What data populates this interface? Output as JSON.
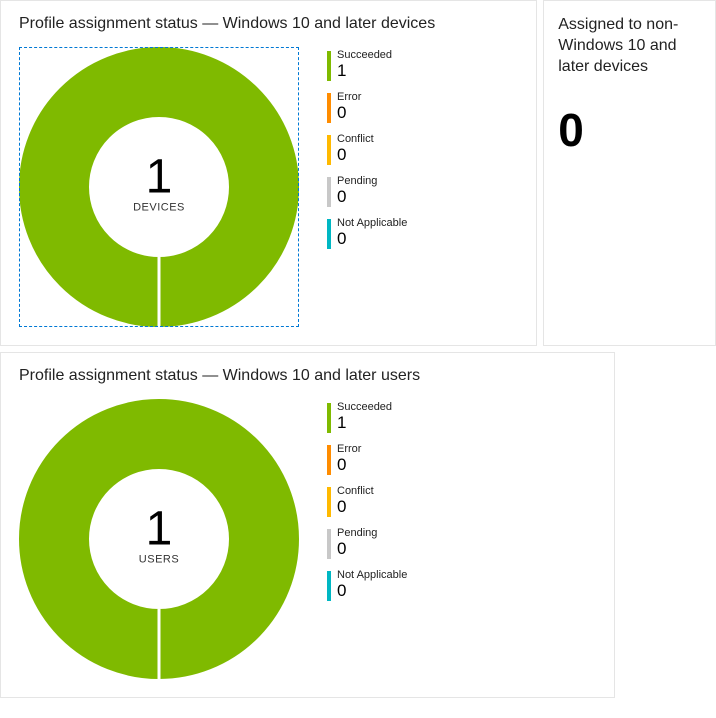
{
  "devices_card": {
    "title": "Profile assignment status — Windows 10 and later devices",
    "center_value": "1",
    "center_label": "DEVICES",
    "legend": [
      {
        "label": "Succeeded",
        "value": "1",
        "color": "#7FBA00"
      },
      {
        "label": "Error",
        "value": "0",
        "color": "#FF8C00"
      },
      {
        "label": "Conflict",
        "value": "0",
        "color": "#FFB900"
      },
      {
        "label": "Pending",
        "value": "0",
        "color": "#C8C8C8"
      },
      {
        "label": "Not Applicable",
        "value": "0",
        "color": "#00B7C3"
      }
    ]
  },
  "users_card": {
    "title": "Profile assignment status — Windows 10 and later users",
    "center_value": "1",
    "center_label": "USERS",
    "legend": [
      {
        "label": "Succeeded",
        "value": "1",
        "color": "#7FBA00"
      },
      {
        "label": "Error",
        "value": "0",
        "color": "#FF8C00"
      },
      {
        "label": "Conflict",
        "value": "0",
        "color": "#FFB900"
      },
      {
        "label": "Pending",
        "value": "0",
        "color": "#C8C8C8"
      },
      {
        "label": "Not Applicable",
        "value": "0",
        "color": "#00B7C3"
      }
    ]
  },
  "side_card": {
    "title": "Assigned to non-Windows 10 and later devices",
    "value": "0"
  },
  "chart_data": [
    {
      "type": "pie",
      "title": "Profile assignment status — Windows 10 and later devices",
      "categories": [
        "Succeeded",
        "Error",
        "Conflict",
        "Pending",
        "Not Applicable"
      ],
      "values": [
        1,
        0,
        0,
        0,
        0
      ],
      "center_value": 1,
      "center_label": "DEVICES"
    },
    {
      "type": "pie",
      "title": "Profile assignment status — Windows 10 and later users",
      "categories": [
        "Succeeded",
        "Error",
        "Conflict",
        "Pending",
        "Not Applicable"
      ],
      "values": [
        1,
        0,
        0,
        0,
        0
      ],
      "center_value": 1,
      "center_label": "USERS"
    }
  ]
}
